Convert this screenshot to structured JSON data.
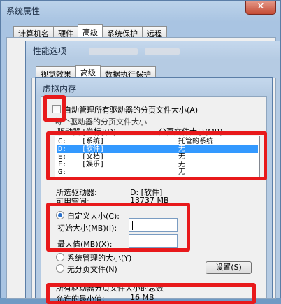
{
  "system_properties": {
    "title": "系统属性",
    "close_glyph": "✕",
    "tabs": [
      {
        "label": "计算机名"
      },
      {
        "label": "硬件"
      },
      {
        "label": "高级"
      },
      {
        "label": "系统保护"
      },
      {
        "label": "远程"
      }
    ]
  },
  "performance_options": {
    "title": "性能选项",
    "tabs": [
      {
        "label": "视觉效果"
      },
      {
        "label": "高级"
      },
      {
        "label": "数据执行保护"
      }
    ]
  },
  "virtual_memory": {
    "title": "虚拟内存",
    "auto_manage_label": "自动管理所有驱动器的分页文件大小(A)",
    "auto_manage_checked": false,
    "group_label": "每个驱动器的分页文件大小",
    "col_drive": "驱动器 [卷标](D)",
    "col_size": "分页文件大小(MB)",
    "drives": [
      {
        "drive": "C:",
        "label": "[系统]",
        "size": "托管的系统"
      },
      {
        "drive": "D:",
        "label": "[软件]",
        "size": "无"
      },
      {
        "drive": "E:",
        "label": "[文档]",
        "size": "无"
      },
      {
        "drive": "F:",
        "label": "[娱乐]",
        "size": "无"
      },
      {
        "drive": "G:",
        "label": "",
        "size": "无"
      }
    ],
    "selected_drive_label": "所选驱动器:",
    "selected_drive_value": "D: [软件]",
    "free_space_label": "可用空间:",
    "free_space_value": "13737 MB",
    "custom_size_label": "自定义大小(C):",
    "initial_size_label": "初始大小(MB)(I):",
    "initial_size_value": "",
    "max_size_label": "最大值(MB)(X):",
    "max_size_value": "",
    "system_managed_label": "系统管理的大小(Y)",
    "no_paging_label": "无分页文件(N)",
    "set_button": "设置(S)",
    "total_label": "所有驱动器分页文件大小的总数",
    "min_allowed_label": "允许的最小值:",
    "min_allowed_value": "16 MB",
    "selected_option": "custom"
  },
  "colors": {
    "highlight": "#e8191b",
    "selection": "#3399ff"
  }
}
